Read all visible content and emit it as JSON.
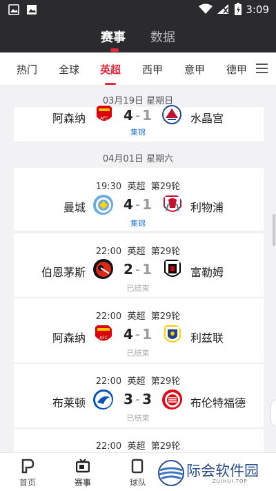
{
  "status_bar": {
    "time": "3:09"
  },
  "header": {
    "tabs": [
      {
        "label": "赛事",
        "active": true
      },
      {
        "label": "数据",
        "active": false
      }
    ]
  },
  "leagues": {
    "tabs": [
      {
        "label": "热门"
      },
      {
        "label": "全球"
      },
      {
        "label": "英超",
        "active": true
      },
      {
        "label": "西甲"
      },
      {
        "label": "意甲"
      },
      {
        "label": "德甲"
      }
    ]
  },
  "groups": [
    {
      "date": "03月19日 星期日"
    },
    {
      "date": "04月01日 星期六"
    }
  ],
  "matches": [
    {
      "time": "",
      "league": "",
      "round": "",
      "home": "阿森纳",
      "away": "水晶宫",
      "home_score": "4",
      "away_score": "1",
      "state": "集锦"
    },
    {
      "time": "19:30",
      "league": "英超",
      "round": "第29轮",
      "home": "曼城",
      "away": "利物浦",
      "home_score": "4",
      "away_score": "1",
      "state": "集锦"
    },
    {
      "time": "22:00",
      "league": "英超",
      "round": "第29轮",
      "home": "伯恩茅斯",
      "away": "富勒姆",
      "home_score": "2",
      "away_score": "1",
      "state": "已结束"
    },
    {
      "time": "22:00",
      "league": "英超",
      "round": "第29轮",
      "home": "阿森纳",
      "away": "利兹联",
      "home_score": "4",
      "away_score": "1",
      "state": "已结束"
    },
    {
      "time": "22:00",
      "league": "英超",
      "round": "第29轮",
      "home": "布莱顿",
      "away": "布伦特福德",
      "home_score": "3",
      "away_score": "3",
      "state": "已结束"
    },
    {
      "time": "22:00",
      "league": "英超",
      "round": "第29轮"
    }
  ],
  "bottom_nav": [
    {
      "label": "首页",
      "icon": "home-icon"
    },
    {
      "label": "赛事",
      "icon": "tv-icon",
      "active": true
    },
    {
      "label": "球队",
      "icon": "team-icon"
    }
  ],
  "watermark": {
    "text": "际会软件园",
    "sub": "ZUIHUI.TOP"
  },
  "colors": {
    "accent": "#e2293b",
    "header_bg": "#2b2b2e",
    "highlight_link": "#2f7fd6"
  }
}
